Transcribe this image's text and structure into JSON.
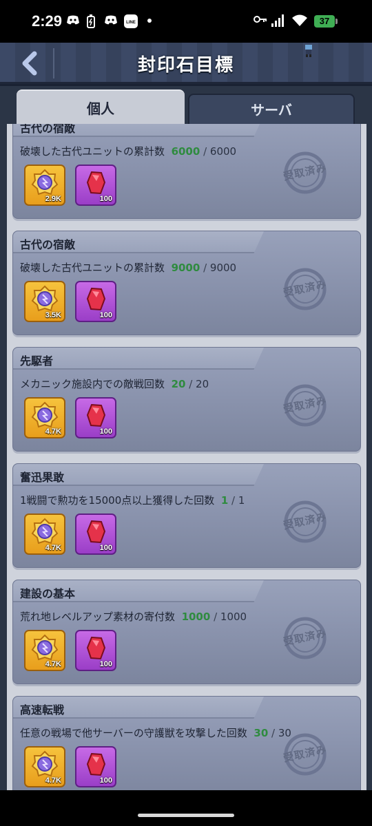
{
  "status_bar": {
    "time": "2:29",
    "battery": "37",
    "icons": [
      "discord-icon",
      "battery-saver-icon",
      "discord-icon",
      "line-icon",
      "dot-icon",
      "key-icon",
      "signal-icon",
      "wifi-icon"
    ]
  },
  "header": {
    "title": "封印石目標"
  },
  "tabs": [
    {
      "label": "個人",
      "active": true
    },
    {
      "label": "サーバ",
      "active": false
    }
  ],
  "missions": [
    {
      "title": "古代の宿敵",
      "desc": "破壊した古代ユニットの累計数",
      "current": "6000",
      "total": "6000",
      "rewards": [
        {
          "icon": "seal-stone-icon",
          "qty": "2.9K"
        },
        {
          "icon": "red-gem-icon",
          "qty": "100"
        }
      ],
      "status": "受取済み"
    },
    {
      "title": "古代の宿敵",
      "desc": "破壊した古代ユニットの累計数",
      "current": "9000",
      "total": "9000",
      "rewards": [
        {
          "icon": "seal-stone-icon",
          "qty": "3.5K"
        },
        {
          "icon": "red-gem-icon",
          "qty": "100"
        }
      ],
      "status": "受取済み"
    },
    {
      "title": "先駆者",
      "desc": "メカニック施設内での敵戦回数",
      "current": "20",
      "total": "20",
      "rewards": [
        {
          "icon": "seal-stone-icon",
          "qty": "4.7K"
        },
        {
          "icon": "red-gem-icon",
          "qty": "100"
        }
      ],
      "status": "受取済み"
    },
    {
      "title": "奮迅果敢",
      "desc": "1戦闘で勲功を15000点以上獲得した回数",
      "current": "1",
      "total": "1",
      "rewards": [
        {
          "icon": "seal-stone-icon",
          "qty": "4.7K"
        },
        {
          "icon": "red-gem-icon",
          "qty": "100"
        }
      ],
      "status": "受取済み"
    },
    {
      "title": "建設の基本",
      "desc": "荒れ地レベルアップ素材の寄付数",
      "current": "1000",
      "total": "1000",
      "rewards": [
        {
          "icon": "seal-stone-icon",
          "qty": "4.7K"
        },
        {
          "icon": "red-gem-icon",
          "qty": "100"
        }
      ],
      "status": "受取済み"
    },
    {
      "title": "高速転戦",
      "desc": "任意の戦場で他サーバーの守護獣を攻撃した回数",
      "current": "30",
      "total": "30",
      "rewards": [
        {
          "icon": "seal-stone-icon",
          "qty": "4.7K"
        },
        {
          "icon": "red-gem-icon",
          "qty": "100"
        }
      ],
      "status": "受取済み"
    }
  ],
  "colors": {
    "progress_current": "#2f8b3f",
    "card_bg": "#8b94ae",
    "header_bg": "#3c4966"
  }
}
